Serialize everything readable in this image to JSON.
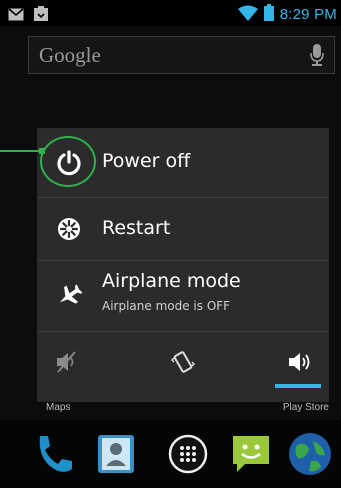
{
  "status_bar": {
    "time": "8:29 PM",
    "left_icons": [
      "gmail-icon",
      "download-notification-icon"
    ],
    "right_icons": [
      "wifi-icon",
      "battery-icon"
    ]
  },
  "search": {
    "placeholder": "Google",
    "mic_icon": "microphone-icon"
  },
  "power_dialog": {
    "items": [
      {
        "icon": "power-icon",
        "label": "Power off"
      },
      {
        "icon": "restart-icon",
        "label": "Restart"
      },
      {
        "icon": "airplane-icon",
        "label": "Airplane mode",
        "status": "Airplane mode is OFF"
      }
    ],
    "sound_modes": [
      {
        "icon": "silent-icon",
        "selected": false
      },
      {
        "icon": "vibrate-icon",
        "selected": false
      },
      {
        "icon": "sound-on-icon",
        "selected": true
      }
    ]
  },
  "home_labels": {
    "left": "Maps",
    "right": "Play Store"
  },
  "dock": [
    "phone-icon",
    "contacts-icon",
    "app-drawer-icon",
    "messaging-icon",
    "browser-icon"
  ],
  "colors": {
    "accent": "#33b5e5",
    "annotation": "#2fb24c",
    "dialog_bg": "#2b2b2b"
  }
}
